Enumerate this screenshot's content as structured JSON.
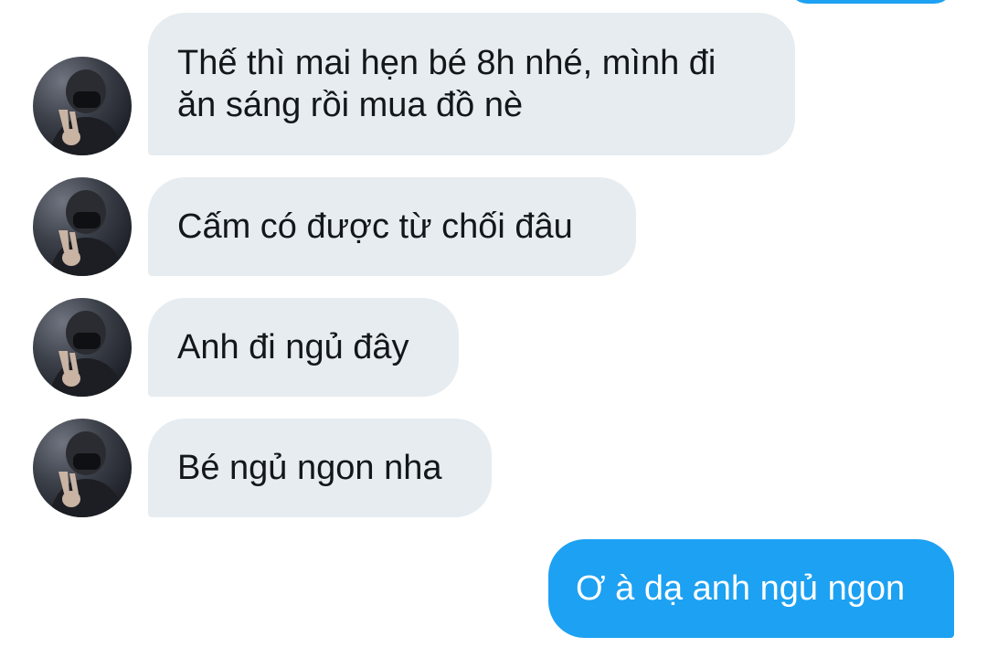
{
  "conversation": {
    "messages": [
      {
        "sender": "other",
        "text": "Thế thì mai hẹn bé 8h nhé, mình đi\năn sáng rồi mua đồ nè"
      },
      {
        "sender": "other",
        "text": "Cấm có được từ chối đâu"
      },
      {
        "sender": "other",
        "text": "Anh đi ngủ đây"
      },
      {
        "sender": "other",
        "text": "Bé ngủ ngon nha"
      },
      {
        "sender": "self",
        "text": "Ơ à dạ anh ngủ ngon"
      }
    ]
  },
  "colors": {
    "incoming_bubble": "#e6ecf0",
    "outgoing_bubble": "#1da1f2",
    "incoming_text": "#14171a",
    "outgoing_text": "#ffffff"
  },
  "icons": {
    "avatar": "avatar-photo"
  }
}
